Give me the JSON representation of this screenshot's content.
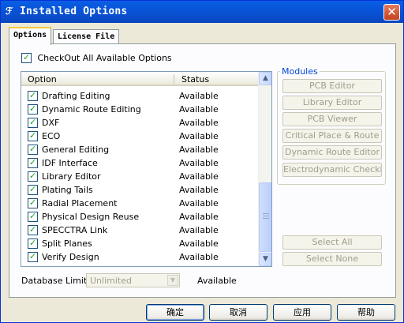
{
  "window": {
    "title": "Installed Options",
    "close_glyph": "✕",
    "title_icon": "app-icon"
  },
  "tabs": [
    {
      "label": "Options",
      "active": true
    },
    {
      "label": "License File",
      "active": false
    }
  ],
  "checkout_all": {
    "label": "CheckOut All Available Options",
    "checked": true
  },
  "list": {
    "headers": {
      "option": "Option",
      "status": "Status"
    },
    "rows": [
      {
        "option": "Drafting Editing",
        "status": "Available",
        "checked": true
      },
      {
        "option": "Dynamic Route Editing",
        "status": "Available",
        "checked": true
      },
      {
        "option": "DXF",
        "status": "Available",
        "checked": true
      },
      {
        "option": "ECO",
        "status": "Available",
        "checked": true
      },
      {
        "option": "General Editing",
        "status": "Available",
        "checked": true
      },
      {
        "option": "IDF Interface",
        "status": "Available",
        "checked": true
      },
      {
        "option": "Library Editor",
        "status": "Available",
        "checked": true
      },
      {
        "option": "Plating Tails",
        "status": "Available",
        "checked": true
      },
      {
        "option": "Radial Placement",
        "status": "Available",
        "checked": true
      },
      {
        "option": "Physical Design Reuse",
        "status": "Available",
        "checked": true
      },
      {
        "option": "SPECCTRA Link",
        "status": "Available",
        "checked": true
      },
      {
        "option": "Split Planes",
        "status": "Available",
        "checked": true
      },
      {
        "option": "Verify Design",
        "status": "Available",
        "checked": true
      }
    ]
  },
  "modules": {
    "title": "Modules",
    "buttons": [
      "PCB Editor",
      "Library Editor",
      "PCB Viewer",
      "Critical Place & Route",
      "Dynamic Route Editor",
      "Electrodynamic Checking"
    ]
  },
  "select_all": "Select All",
  "select_none": "Select None",
  "database_limit": {
    "label": "Database Limit:",
    "value": "Unlimited",
    "status": "Available"
  },
  "footer": {
    "ok": "确定",
    "cancel": "取消",
    "apply": "应用",
    "help": "帮助"
  }
}
